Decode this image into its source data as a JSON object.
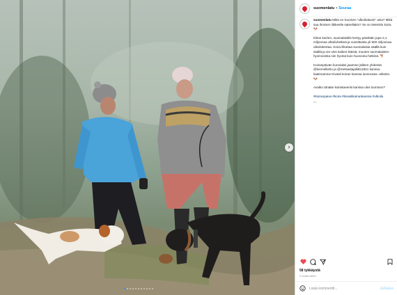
{
  "post": {
    "username": "suomenlatu",
    "separator": "•",
    "follow_label": "Seuraa",
    "caption": {
      "username": "suomenlatu",
      "paragraph1": "Mikä on Suomen \"ulkoiluttavin\" asia? Mikä saa ihmisen liikkeelle sateellakin? Se on tietenkin koira 🐶",
      "paragraph2": "Kiitos koirien, suomalaisille kertyy päivittäin jopa 2,1 miljoonaa ulkoiluhetkeä ja vuosittaisia yli 500 miljoonaa ulkoilukertaa. Koira liikuttaa suomalaisia säällä kuin säällä ja vie ulos kaiken ikäisiä, muuten suomalaisten hyvinvointia niin hyvinä kuin huonoina hetkinä. 🐕",
      "paragraph3": "Koiranpäivän kunniaksi jaamme jälleen yhdessä @kennelkirtio ja @metsastajaliitto1921 kanssa laatimamme Kivasti koiran kanssa luonnossa -etiketin. 🐶",
      "paragraph4": "Avatko tänään koirakaverisi kanssa ulos luontoon?",
      "hashtags": "#koiranpaiva #koira #kivastikoirankanssa #ulkoilu",
      "timestamp": "2 t"
    },
    "likes": "58 tykkäystä",
    "time_ago": "2 tuntia sitten",
    "comment_placeholder": "Lisää kommentti...",
    "post_label": "Julkaise",
    "carousel": {
      "total": 11,
      "active_index": 0
    }
  },
  "icons": {
    "avatar": "suomen-latu-logo",
    "like": "heart-icon",
    "comment": "comment-icon",
    "share": "share-icon",
    "save": "bookmark-icon",
    "emoji": "emoji-icon",
    "next": "chevron-right-icon"
  },
  "colors": {
    "like": "#ed4956",
    "link": "#0095f6",
    "hashtag": "#00376b"
  }
}
